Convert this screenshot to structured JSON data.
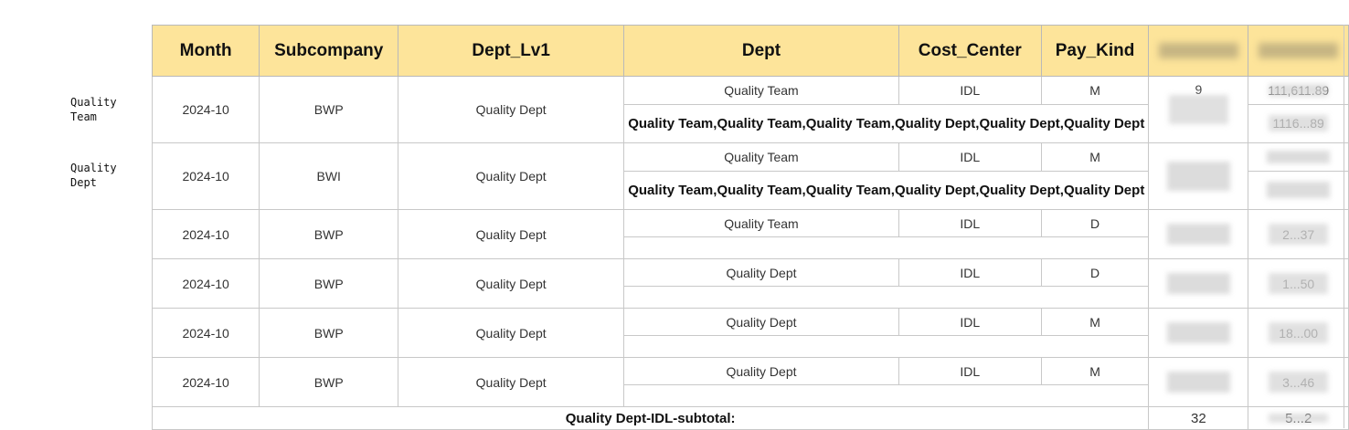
{
  "side_labels": [
    {
      "line1": "Quality",
      "line2": "Team"
    },
    {
      "line1": "Quality",
      "line2": "Dept"
    }
  ],
  "headers": {
    "month": "Month",
    "subcompany": "Subcompany",
    "dept_lv1": "Dept_Lv1",
    "dept": "Dept",
    "cost_center": "Cost_Center",
    "pay_kind": "Pay_Kind",
    "headcount": "H",
    "amount": ""
  },
  "rows": [
    {
      "month": "2024-10",
      "subcompany": "BWP",
      "dept_lv1": "Quality Dept",
      "dept": "Quality Team",
      "cost_center": "IDL",
      "pay_kind": "M",
      "headcount": "9",
      "amount": "111,611.89",
      "dept_detail": "Quality Team,Quality Team,Quality Team,Quality Dept,Quality Dept,Quality Dept",
      "amount_detail": "1116...89"
    },
    {
      "month": "2024-10",
      "subcompany": "BWI",
      "dept_lv1": "Quality Dept",
      "dept": "Quality Team",
      "cost_center": "IDL",
      "pay_kind": "M",
      "headcount": "",
      "amount": "",
      "dept_detail": "Quality Team,Quality Team,Quality Team,Quality Dept,Quality Dept,Quality Dept",
      "amount_detail": ""
    },
    {
      "month": "2024-10",
      "subcompany": "BWP",
      "dept_lv1": "Quality Dept",
      "dept": "Quality Team",
      "cost_center": "IDL",
      "pay_kind": "D",
      "headcount": "",
      "amount": "2...37"
    },
    {
      "month": "2024-10",
      "subcompany": "BWP",
      "dept_lv1": "Quality Dept",
      "dept": "Quality Dept",
      "cost_center": "IDL",
      "pay_kind": "D",
      "headcount": "",
      "amount": "1...50"
    },
    {
      "month": "2024-10",
      "subcompany": "BWP",
      "dept_lv1": "Quality Dept",
      "dept": "Quality Dept",
      "cost_center": "IDL",
      "pay_kind": "M",
      "headcount": "",
      "amount": "18...00"
    },
    {
      "month": "2024-10",
      "subcompany": "BWP",
      "dept_lv1": "Quality Dept",
      "dept": "Quality Dept",
      "cost_center": "IDL",
      "pay_kind": "M",
      "headcount": "",
      "amount": "3...46"
    }
  ],
  "subtotal": {
    "label": "Quality Dept-IDL-subtotal:",
    "headcount": "32",
    "amount": "5...2"
  }
}
